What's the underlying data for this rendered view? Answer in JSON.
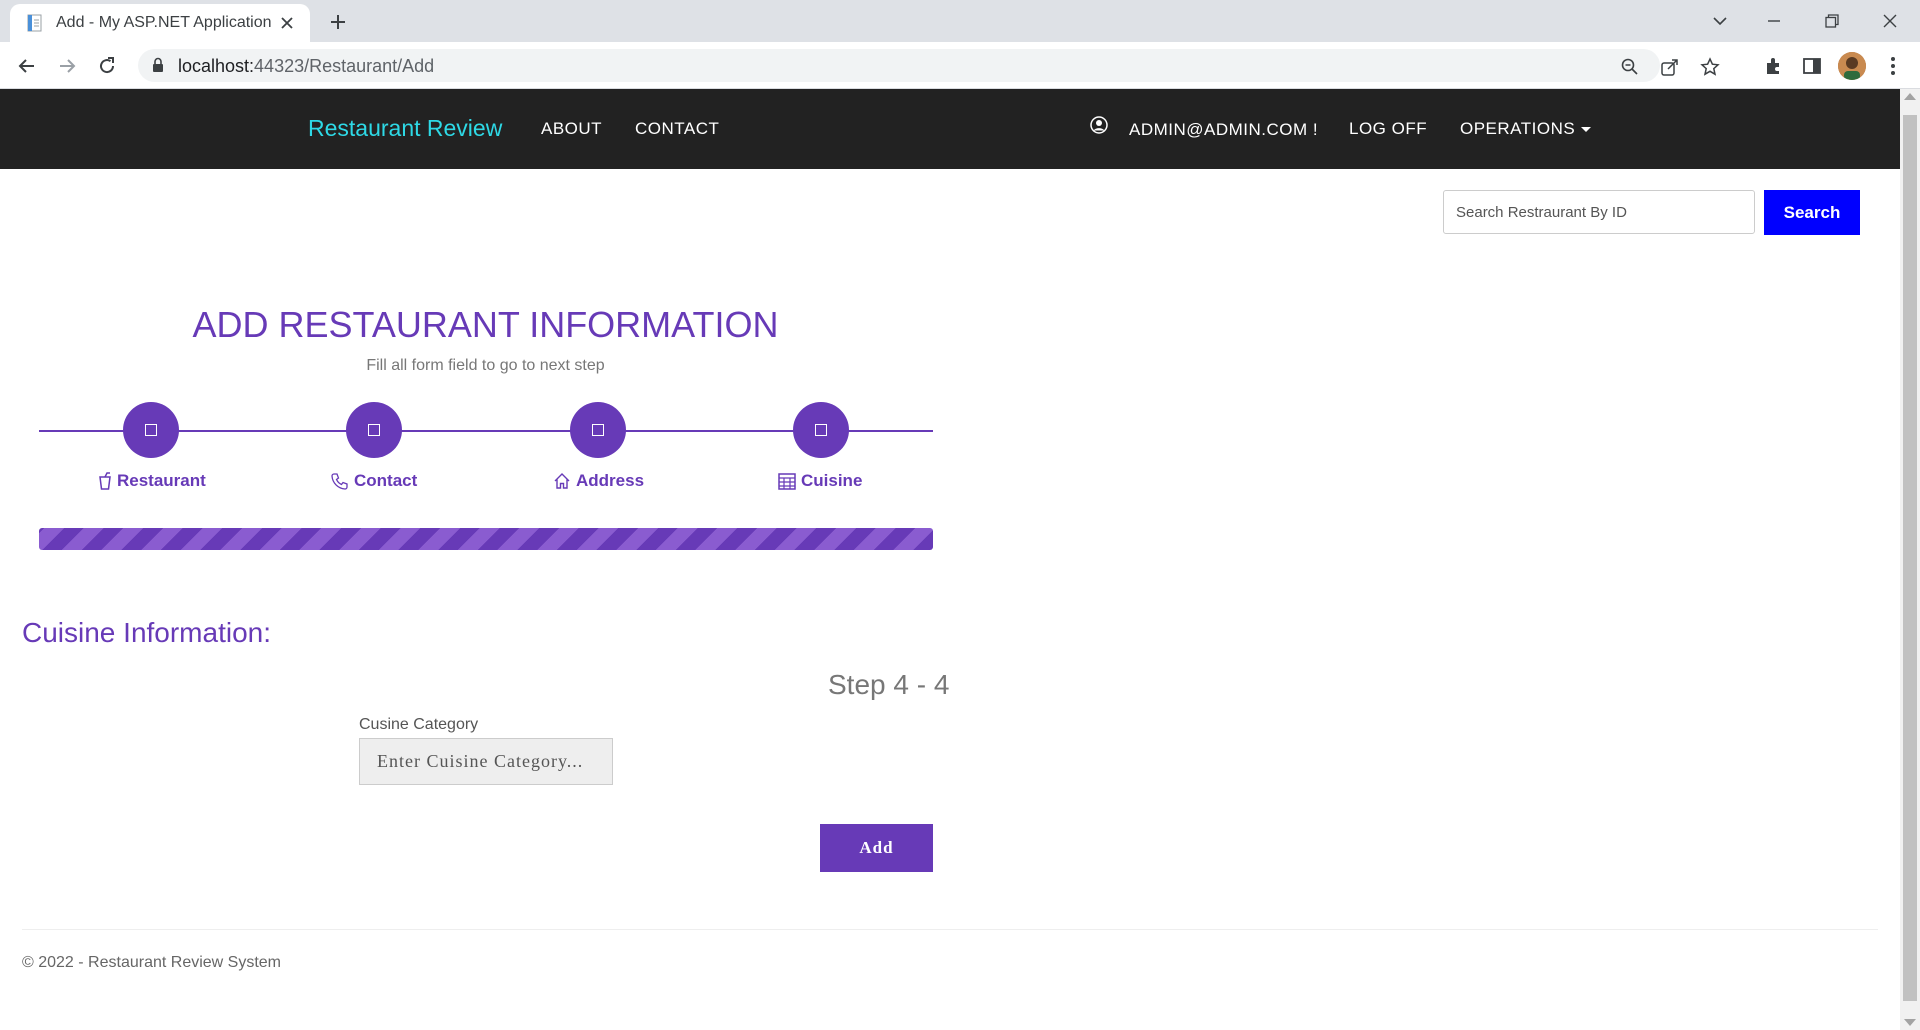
{
  "browser": {
    "tab_title": "Add - My ASP.NET Application",
    "url_host": "localhost:",
    "url_path": "44323/Restaurant/Add"
  },
  "navbar": {
    "brand": "Restaurant Review",
    "links": [
      "ABOUT",
      "CONTACT"
    ],
    "user": "ADMIN@ADMIN.COM !",
    "logoff": "LOG OFF",
    "operations": "OPERATIONS",
    "brand_color": "#2ed9e6",
    "background": "#222222"
  },
  "search": {
    "placeholder": "Search Restraurant By ID",
    "button": "Search",
    "button_color": "#0000ff"
  },
  "form": {
    "title": "ADD RESTAURANT INFORMATION",
    "subtitle": "Fill all form field to go to next step",
    "accent": "#673ab7",
    "steps": [
      {
        "label": "Restaurant",
        "icon": "cup-icon"
      },
      {
        "label": "Contact",
        "icon": "phone-icon"
      },
      {
        "label": "Address",
        "icon": "home-icon"
      },
      {
        "label": "Cuisine",
        "icon": "table-icon"
      }
    ],
    "progress_percent": 100,
    "section_title": "Cuisine Information:",
    "step_count": "Step 4 - 4",
    "field_label": "Cusine Category",
    "field_placeholder": "Enter Cuisine Category...",
    "submit": "Add"
  },
  "footer": {
    "text": "© 2022 - Restaurant Review System"
  }
}
